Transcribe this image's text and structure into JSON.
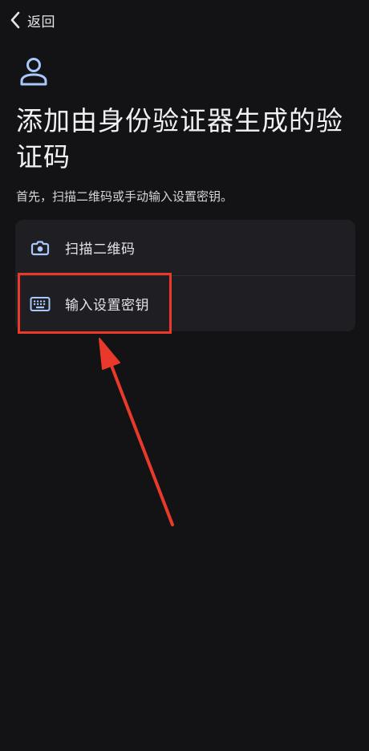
{
  "topbar": {
    "back_label": "返回",
    "back_icon": "chevron-left-icon"
  },
  "hero": {
    "icon": "person-icon",
    "title": "添加由身份验证器生成的验证码",
    "subtitle": "首先，扫描二维码或手动输入设置密钥。"
  },
  "options": [
    {
      "label": "扫描二维码",
      "icon": "camera-icon"
    },
    {
      "label": "输入设置密钥",
      "icon": "keyboard-icon"
    }
  ],
  "annotation": {
    "color": "#e8392b"
  },
  "colors": {
    "background": "#131315",
    "card": "#1f1f23",
    "accent_icon": "#a8c7fa"
  }
}
